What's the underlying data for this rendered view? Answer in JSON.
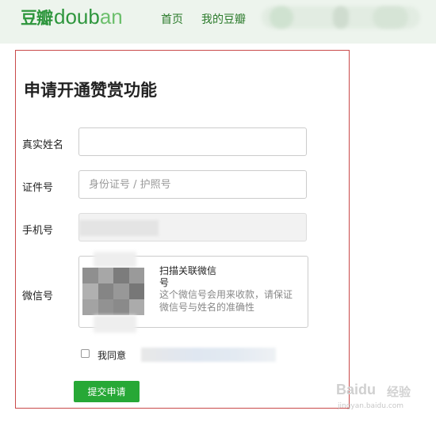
{
  "header": {
    "logo_cn": "豆瓣",
    "logo_en_prefix": "doub",
    "logo_en_suffix": "an",
    "nav": [
      "首页",
      "我的豆瓣"
    ]
  },
  "form": {
    "title": "申请开通赞赏功能",
    "real_name": {
      "label": "真实姓名",
      "value": ""
    },
    "id_number": {
      "label": "证件号",
      "placeholder": "身份证号 / 护照号"
    },
    "phone": {
      "label": "手机号"
    },
    "wechat": {
      "label": "微信号",
      "scan_title": "扫描关联微信号",
      "scan_desc": "这个微信号会用来收款，请保证微信号与姓名的准确性"
    },
    "agree_label": "我同意",
    "submit_label": "提交申请"
  },
  "watermark": {
    "brand": "Baidu",
    "suffix": "经验",
    "url": "jingyan.baidu.com"
  },
  "colors": {
    "brand_green": "#2e963d",
    "submit_green": "#27a836",
    "card_border": "#c94a4a",
    "header_bg": "#edf4ed"
  }
}
